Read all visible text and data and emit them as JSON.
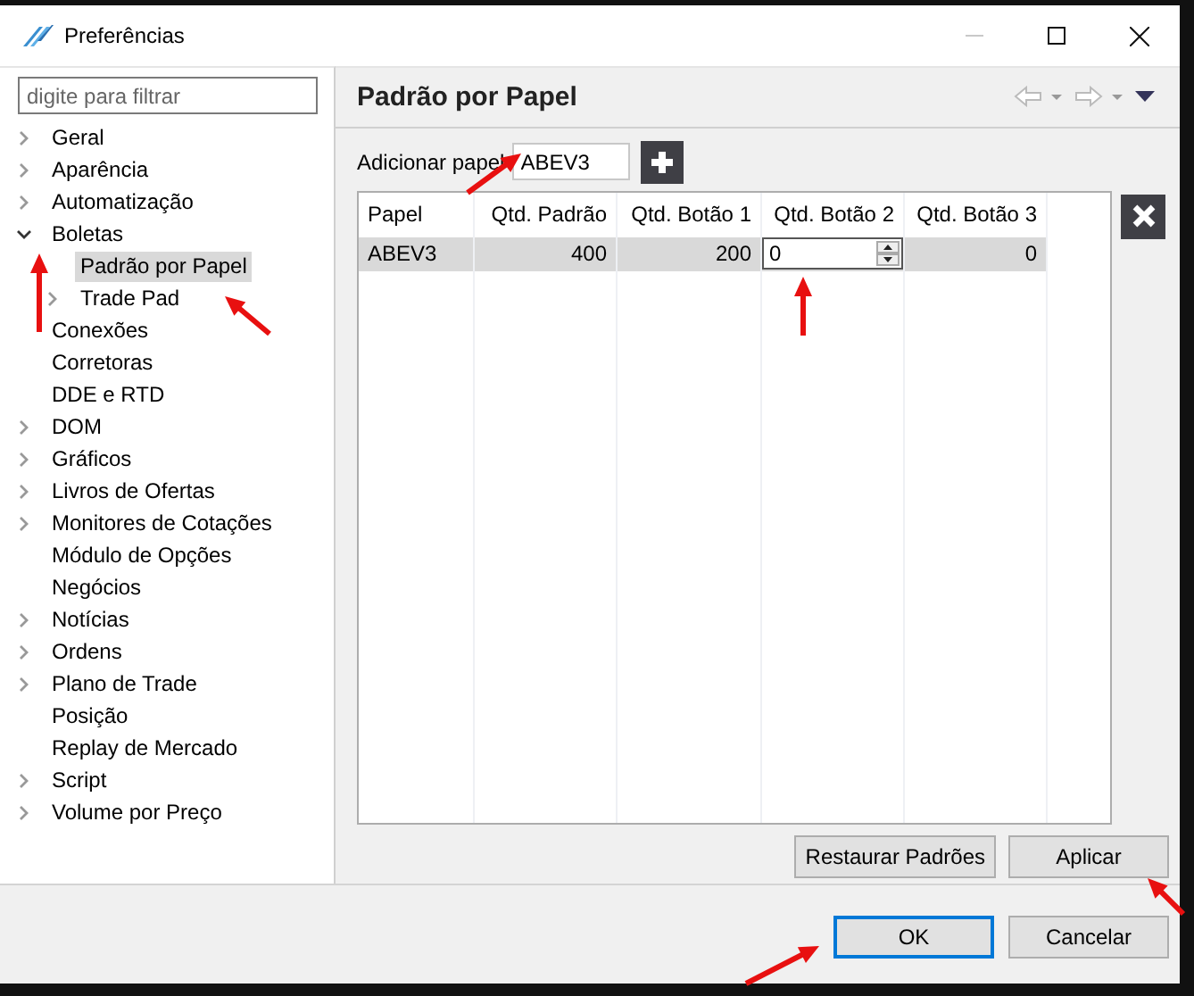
{
  "window": {
    "title": "Preferências",
    "controls": [
      {
        "kind": "minimize",
        "disabled": true
      },
      {
        "kind": "maximize",
        "disabled": false
      },
      {
        "kind": "close",
        "disabled": false
      }
    ]
  },
  "sidebar": {
    "filter": {
      "placeholder": "digite para filtrar"
    },
    "items": [
      {
        "label": "Geral",
        "expanded": false,
        "selected": false
      },
      {
        "label": "Aparência",
        "expanded": false,
        "selected": false
      },
      {
        "label": "Automatização",
        "expanded": false,
        "selected": false
      },
      {
        "label": "Boletas",
        "expanded": true,
        "selected": false,
        "children": [
          {
            "label": "Padrão por Papel",
            "selected": true
          },
          {
            "label": "Trade Pad",
            "expanded": false,
            "selected": false
          }
        ]
      },
      {
        "label": "Conexões",
        "selected": false
      },
      {
        "label": "Corretoras",
        "selected": false
      },
      {
        "label": "DDE e RTD",
        "selected": false
      },
      {
        "label": "DOM",
        "expanded": false,
        "selected": false
      },
      {
        "label": "Gráficos",
        "expanded": false,
        "selected": false
      },
      {
        "label": "Livros de Ofertas",
        "expanded": false,
        "selected": false
      },
      {
        "label": "Monitores de Cotações",
        "expanded": false,
        "selected": false
      },
      {
        "label": "Módulo de Opções",
        "selected": false
      },
      {
        "label": "Negócios",
        "selected": false
      },
      {
        "label": "Notícias",
        "expanded": false,
        "selected": false
      },
      {
        "label": "Ordens",
        "expanded": false,
        "selected": false
      },
      {
        "label": "Plano de Trade",
        "expanded": false,
        "selected": false
      },
      {
        "label": "Posição",
        "selected": false
      },
      {
        "label": "Replay de Mercado",
        "selected": false
      },
      {
        "label": "Script",
        "expanded": false,
        "selected": false
      },
      {
        "label": "Volume por Preço",
        "expanded": false,
        "selected": false
      }
    ]
  },
  "page": {
    "title": "Padrão por Papel",
    "nav": [
      {
        "kind": "back",
        "disabled": true
      },
      {
        "kind": "forward",
        "disabled": true
      },
      {
        "kind": "menu",
        "disabled": false
      }
    ],
    "add_field": {
      "label": "Adicionar papel",
      "value": "ABEV3"
    },
    "table": {
      "columns": [
        "Papel",
        "Qtd. Padrão",
        "Qtd. Botão 1",
        "Qtd. Botão 2",
        "Qtd. Botão 3"
      ],
      "rows": [
        {
          "selected": true,
          "cells": [
            {
              "kind": "text",
              "value": "ABEV3"
            },
            {
              "kind": "text",
              "value": "400"
            },
            {
              "kind": "text",
              "value": "200"
            },
            {
              "kind": "spinner",
              "value": "0"
            },
            {
              "kind": "text",
              "value": "0"
            }
          ]
        }
      ]
    },
    "buttons": [
      "Restaurar Padrões",
      "Aplicar"
    ]
  },
  "footer": {
    "buttons": [
      {
        "label": "OK",
        "default": true
      },
      {
        "label": "Cancelar",
        "default": false
      }
    ]
  }
}
